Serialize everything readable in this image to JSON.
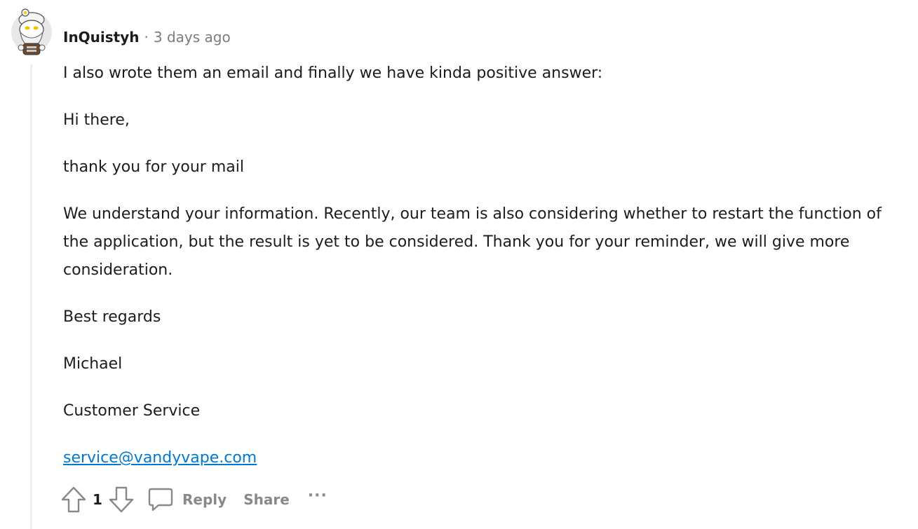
{
  "comment": {
    "author": "InQuistyh",
    "separator": "·",
    "timestamp": "3 days ago",
    "paragraphs": [
      "I also wrote them an email and finally we have kinda positive answer:",
      "Hi there,",
      "thank you for your mail",
      "We understand your information. Recently, our team is also considering whether to restart the function of the application, but the result is yet to be considered. Thank you for your reminder, we will give more consideration.",
      "Best regards",
      "Michael",
      "Customer Service"
    ],
    "email_link": "service@vandyvape.com"
  },
  "actions": {
    "vote_count": "1",
    "reply_label": "Reply",
    "share_label": "Share",
    "more_label": "···"
  },
  "icons": {
    "upvote": "upvote-arrow-icon",
    "downvote": "downvote-arrow-icon",
    "reply": "speech-bubble-icon",
    "more": "ellipsis-icon"
  },
  "colors": {
    "text": "#1c1c1c",
    "muted": "#7c7c7c",
    "action": "#878a8c",
    "link": "#0079d3",
    "thread_line": "#edeff1"
  }
}
